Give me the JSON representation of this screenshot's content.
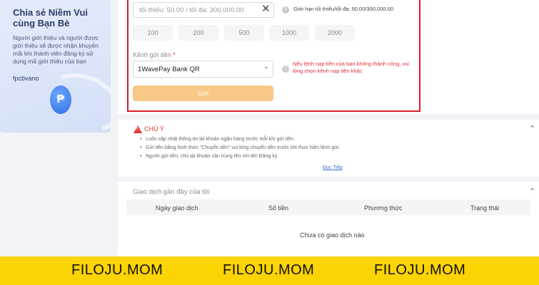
{
  "promo": {
    "title": "Chia sẻ Niềm Vui cùng Bạn Bè",
    "description": "Người giới thiệu và người được giới thiệu sẽ được nhận khuyến mãi khi thành viên đăng ký sử dụng mã giới thiệu của bạn",
    "referral_code": "fpcbvano",
    "coin_symbol": "₱"
  },
  "deposit": {
    "amount_placeholder": "tối thiểu: 50.00 / tối đa: 300,000.00",
    "clear_symbol": "✕",
    "limit_hint": "Giới hạn tối thiểu/tối đa: 50.00/300,000.00",
    "quick_amounts": [
      "100",
      "200",
      "500",
      "1000",
      "2000"
    ],
    "channel_label": "Kênh gửi tiền",
    "required_mark": "*",
    "channel_value": "1WavePay Bank QR",
    "channel_hint": "Nếu lệnh nạp tiền của bạn không thành công, vui lòng chọn kênh nạp tiền khác",
    "submit_label": "Gửi",
    "info_symbol": "!"
  },
  "notice": {
    "title": "CHÚ Ý",
    "items": [
      "Luôn cập nhật thông tin tài khoản ngân hàng trước mỗi khi gửi tiền.",
      "Gửi tiền bằng hình thức \"Chuyển tiền\" vui lòng chuyển tiền trước khi thực hiện lệnh gửi.",
      "Người gửi tiền, chủ tài khoản cần trùng tên với tên Đăng ký."
    ],
    "read_more": "Đọc Tiếp"
  },
  "recent": {
    "title": "Giao dịch gần đây của tôi",
    "columns": [
      "Ngày giao dịch",
      "Số tiền",
      "Phương thức",
      "Trạng thái"
    ],
    "empty_text": "Chưa có giao dịch nào"
  },
  "footer": {
    "brands": [
      "FILOJU.MOM",
      "FILOJU.MOM",
      "FILOJU.MOM"
    ]
  },
  "colors": {
    "highlight_border": "#d71d2a",
    "submit_button": "#f8c887",
    "footer_banner": "#fcd303",
    "warning": "#e53935"
  }
}
